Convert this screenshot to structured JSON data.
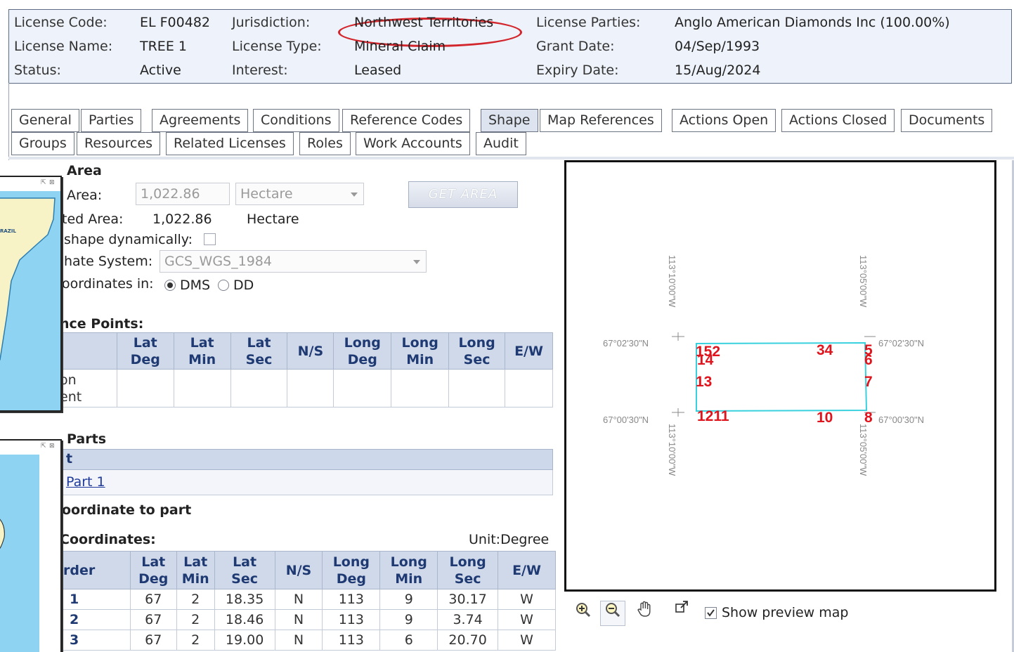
{
  "header": {
    "license_code_label": "License Code:",
    "license_code": "EL F00482",
    "license_name_label": "License Name:",
    "license_name": "TREE 1",
    "status_label": "Status:",
    "status": "Active",
    "jurisdiction_label": "Jurisdiction:",
    "jurisdiction": "Northwest Territories",
    "license_type_label": "License Type:",
    "license_type": "Mineral Claim",
    "interest_label": "Interest:",
    "interest": "Leased",
    "parties_label": "License Parties:",
    "parties": "Anglo American Diamonds Inc (100.00%)",
    "grant_label": "Grant Date:",
    "grant_date": "04/Sep/1993",
    "expiry_label": "Expiry Date:",
    "expiry_date": "15/Aug/2024"
  },
  "tabs": {
    "row1": [
      "General",
      "Parties",
      "Agreements",
      "Conditions",
      "Reference Codes",
      "Shape",
      "Map References",
      "Actions Open",
      "Actions Closed",
      "Documents"
    ],
    "row2": [
      "Groups",
      "Resources",
      "Related Licenses",
      "Roles",
      "Work Accounts",
      "Audit"
    ],
    "active": "Shape"
  },
  "shape": {
    "section_title": "Area",
    "area_label": "Area:",
    "area_value": "1,022.86",
    "area_unit": "Hectare",
    "get_area_button": "GET AREA",
    "calc_label": "ted Area:",
    "calc_value": "1,022.86",
    "calc_unit": "Hectare",
    "dynamic_label": "shape dynamically:",
    "coord_system_label": "hate System:",
    "coord_system": "GCS_WGS_1984",
    "coords_in_label": "oordinates in:",
    "dms_label": "DMS",
    "dd_label": "DD",
    "ref_points_title": "nce Points:",
    "ref_points_headers": [
      "Lat\nDeg",
      "Lat\nMin",
      "Lat\nSec",
      "N/S",
      "Long\nDeg",
      "Long\nMin",
      "Long\nSec",
      "E/W"
    ],
    "ref_points_row_label_1": "on",
    "ref_points_row_label_2": "ent",
    "parts_title": "Parts",
    "parts_header": "t",
    "part_1": "Part 1",
    "add_coord_title": "oordinate to part",
    "coords_title": "Coordinates:",
    "unit_label": "Unit:Degree",
    "coords_headers": [
      "rder",
      "Lat\nDeg",
      "Lat\nMin",
      "Lat\nSec",
      "N/S",
      "Long\nDeg",
      "Long\nMin",
      "Long\nSec",
      "E/W"
    ],
    "coords_rows": [
      [
        "1",
        "67",
        "2",
        "18.35",
        "N",
        "113",
        "9",
        "30.17",
        "W"
      ],
      [
        "2",
        "67",
        "2",
        "18.46",
        "N",
        "113",
        "9",
        "3.74",
        "W"
      ],
      [
        "3",
        "67",
        "2",
        "19.00",
        "N",
        "113",
        "6",
        "20.70",
        "W"
      ]
    ]
  },
  "thumbs": {
    "country_label": "RAZIL"
  },
  "map": {
    "grid_labels": {
      "lat_top_left": "67°02'30\"N",
      "lat_top_right": "67°02'30\"N",
      "lat_bottom_left": "67°00'30\"N",
      "lat_bottom_right": "67°00'30\"N",
      "lon_left_top": "113°10'00\"W",
      "lon_right_top": "113°05'00\"W",
      "lon_left_bottom": "113°10'00\"W",
      "lon_right_bottom": "113°05'00\"W"
    },
    "vertex_labels": [
      "152",
      "14",
      "34",
      "5",
      "6",
      "13",
      "7",
      "1211",
      "10",
      "8"
    ],
    "show_preview_label": "Show preview map",
    "outline_color": "#39d1de",
    "label_color": "#e0141c"
  },
  "icons": {
    "zoom_in": "zoom-in-icon",
    "zoom_out": "zoom-out-icon",
    "pan": "pan-hand-icon",
    "popout": "popout-icon"
  }
}
